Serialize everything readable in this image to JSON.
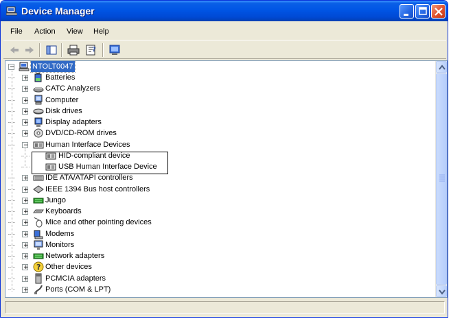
{
  "window": {
    "title": "Device Manager"
  },
  "menu": [
    "File",
    "Action",
    "View",
    "Help"
  ],
  "tree": {
    "root": "NTOLT0047",
    "categories": [
      {
        "label": "Batteries",
        "icon": "battery-icon"
      },
      {
        "label": "CATC Analyzers",
        "icon": "analyzer-icon"
      },
      {
        "label": "Computer",
        "icon": "computer-icon"
      },
      {
        "label": "Disk drives",
        "icon": "disk-drive-icon"
      },
      {
        "label": "Display adapters",
        "icon": "display-adapter-icon"
      },
      {
        "label": "DVD/CD-ROM drives",
        "icon": "cdrom-icon"
      },
      {
        "label": "Human Interface Devices",
        "icon": "hid-icon",
        "expanded": true
      },
      {
        "label": "HID-compliant device",
        "icon": "hid-device-icon",
        "child": true
      },
      {
        "label": "USB Human Interface Device",
        "icon": "hid-device-icon",
        "child": true
      },
      {
        "label": "IDE ATA/ATAPI controllers",
        "icon": "ide-controller-icon"
      },
      {
        "label": "IEEE 1394 Bus host controllers",
        "icon": "ieee1394-icon"
      },
      {
        "label": "Jungo",
        "icon": "jungo-icon"
      },
      {
        "label": "Keyboards",
        "icon": "keyboard-icon"
      },
      {
        "label": "Mice and other pointing devices",
        "icon": "mouse-icon"
      },
      {
        "label": "Modems",
        "icon": "modem-icon"
      },
      {
        "label": "Monitors",
        "icon": "monitor-icon"
      },
      {
        "label": "Network adapters",
        "icon": "network-adapter-icon"
      },
      {
        "label": "Other devices",
        "icon": "unknown-device-icon"
      },
      {
        "label": "PCMCIA adapters",
        "icon": "pcmcia-icon"
      },
      {
        "label": "Ports (COM & LPT)",
        "icon": "port-icon"
      }
    ]
  },
  "colors": {
    "titlebar": "#0055e5",
    "selection": "#316ac5",
    "annotation": "#000000"
  }
}
